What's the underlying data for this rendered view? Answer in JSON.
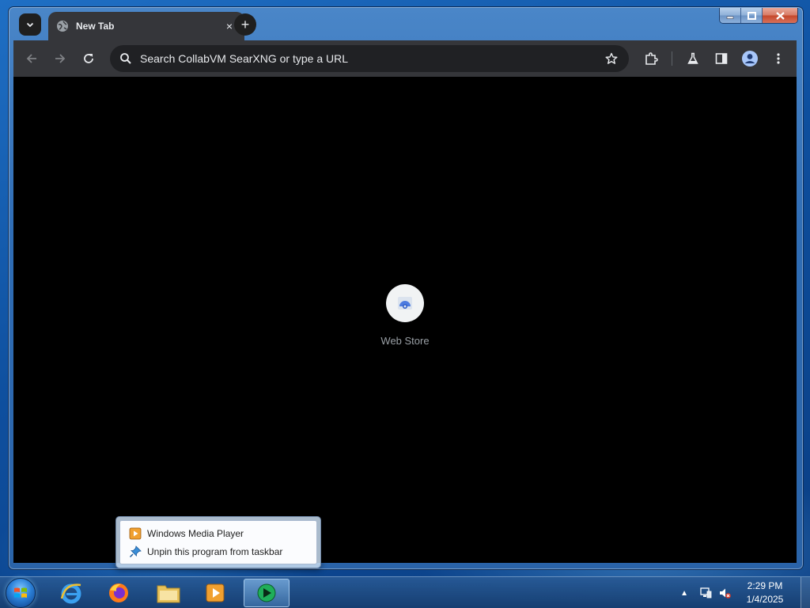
{
  "browser": {
    "tab": {
      "title": "New Tab",
      "close_symbol": "×"
    },
    "newtab_symbol": "+",
    "omnibox": {
      "placeholder": "Search CollabVM SearXNG or type a URL"
    },
    "icons": {
      "tab_search": "chevron-down-icon",
      "favicon": "globe-icon",
      "back": "arrow-left-icon",
      "forward": "arrow-right-icon",
      "reload": "reload-icon",
      "search": "search-icon",
      "bookmark": "star-icon",
      "extensions": "puzzle-icon",
      "labs": "flask-icon",
      "side_panel": "side-panel-icon",
      "profile": "profile-icon",
      "menu": "kebab-menu-icon"
    },
    "shortcut": {
      "label": "Web Store"
    }
  },
  "window_controls": {
    "minimize": "minimize-icon",
    "maximize": "maximize-icon",
    "close": "close-icon"
  },
  "jumplist": {
    "items": [
      {
        "label": "Windows Media Player",
        "icon": "media-player-icon"
      },
      {
        "label": "Unpin this program from taskbar",
        "icon": "unpin-icon"
      }
    ]
  },
  "taskbar": {
    "apps": [
      {
        "name": "internet-explorer",
        "icon": "ie-icon"
      },
      {
        "name": "firefox",
        "icon": "firefox-icon"
      },
      {
        "name": "explorer",
        "icon": "folder-icon"
      },
      {
        "name": "media-player",
        "icon": "media-player-icon"
      },
      {
        "name": "active-app",
        "icon": "media-center-icon"
      }
    ],
    "tray": {
      "arrow": "▲"
    },
    "clock": {
      "time": "2:29 PM",
      "date": "1/4/2025"
    }
  },
  "colors": {
    "chrome_dark": "#35363a",
    "omnibox_bg": "#202124",
    "content_bg": "#000000",
    "text_light": "#e8eaed",
    "label_gray": "#9aa0a6"
  }
}
